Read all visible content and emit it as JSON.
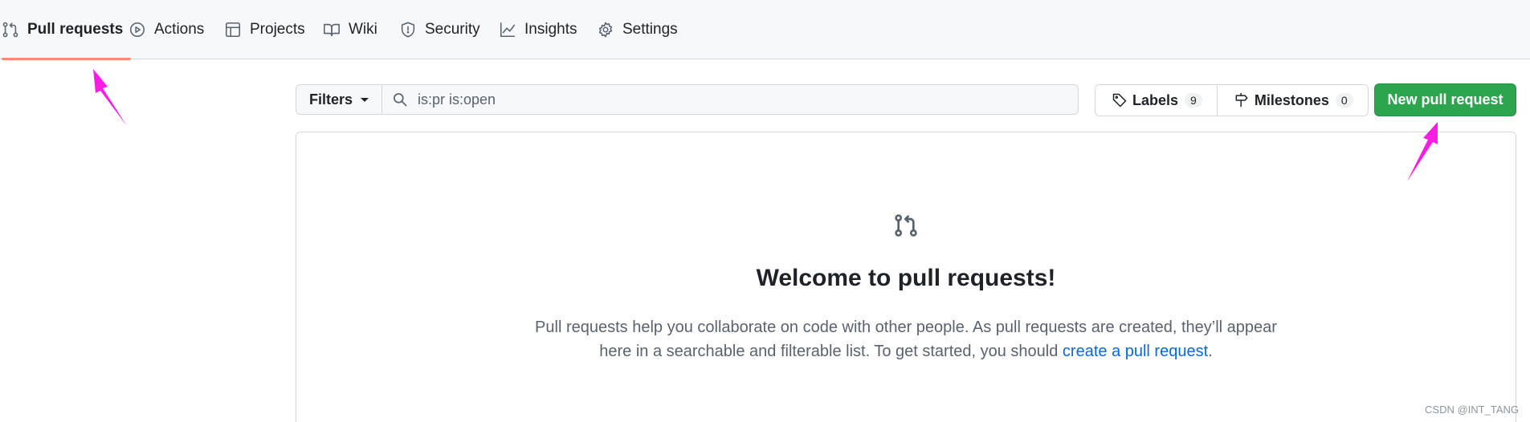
{
  "tabs": [
    {
      "label": "Pull requests",
      "icon": "pull-request-icon",
      "active": true
    },
    {
      "label": "Actions",
      "icon": "play-icon"
    },
    {
      "label": "Projects",
      "icon": "table-icon"
    },
    {
      "label": "Wiki",
      "icon": "book-icon"
    },
    {
      "label": "Security",
      "icon": "shield-icon"
    },
    {
      "label": "Insights",
      "icon": "graph-icon"
    },
    {
      "label": "Settings",
      "icon": "gear-icon"
    }
  ],
  "filters": {
    "label": "Filters"
  },
  "search": {
    "value": "is:pr is:open"
  },
  "labels": {
    "label": "Labels",
    "count": "9"
  },
  "milestones": {
    "label": "Milestones",
    "count": "0"
  },
  "new_pr": {
    "label": "New pull request"
  },
  "blankslate": {
    "title": "Welcome to pull requests!",
    "desc_before": "Pull requests help you collaborate on code with other people. As pull requests are created, they’ll appear here in a searchable and filterable list. To get started, you should ",
    "link": "create a pull request",
    "desc_after": "."
  },
  "annotation_color": "#f81ce5",
  "watermark": "CSDN @INT_TANG"
}
